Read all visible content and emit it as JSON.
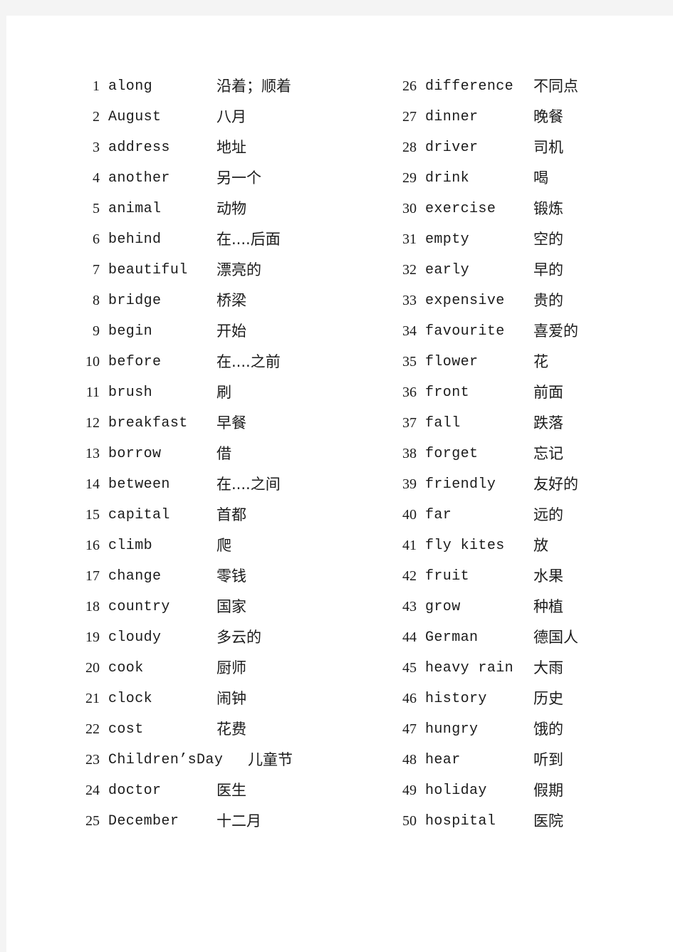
{
  "document": {
    "type": "vocabulary-list",
    "page_background": "#ffffff",
    "margin_background": "#f4f4f4",
    "text_color": "#1b1b1b",
    "total_entries": 50,
    "columns": 2
  },
  "columns": [
    {
      "name": "left-column",
      "entries": [
        {
          "num": "1",
          "word": "along",
          "gloss": "沿着；顺着"
        },
        {
          "num": "2",
          "word": "August",
          "gloss": "八月"
        },
        {
          "num": "3",
          "word": "address",
          "gloss": "地址"
        },
        {
          "num": "4",
          "word": "another",
          "gloss": "另一个"
        },
        {
          "num": "5",
          "word": "animal",
          "gloss": "动物"
        },
        {
          "num": "6",
          "word": "behind",
          "gloss": "在....后面"
        },
        {
          "num": "7",
          "word": "beautiful",
          "gloss": "漂亮的"
        },
        {
          "num": "8",
          "word": "bridge",
          "gloss": "桥梁"
        },
        {
          "num": "9",
          "word": "begin",
          "gloss": "开始"
        },
        {
          "num": "10",
          "word": "before",
          "gloss": "在....之前"
        },
        {
          "num": "11",
          "word": "brush",
          "gloss": "刷"
        },
        {
          "num": "12",
          "word": "breakfast",
          "gloss": "早餐"
        },
        {
          "num": "13",
          "word": "borrow",
          "gloss": "借"
        },
        {
          "num": "14",
          "word": "between",
          "gloss": "在....之间"
        },
        {
          "num": "15",
          "word": "capital",
          "gloss": "首都"
        },
        {
          "num": "16",
          "word": "climb",
          "gloss": "爬"
        },
        {
          "num": "17",
          "word": "change",
          "gloss": "零钱"
        },
        {
          "num": "18",
          "word": "country",
          "gloss": "国家"
        },
        {
          "num": "19",
          "word": "cloudy",
          "gloss": "多云的"
        },
        {
          "num": "20",
          "word": "cook",
          "gloss": "厨师"
        },
        {
          "num": "21",
          "word": "clock",
          "gloss": "闹钟"
        },
        {
          "num": "22",
          "word": "cost",
          "gloss": "花费"
        },
        {
          "num": "23",
          "word": "Children’sDay",
          "gloss": "儿童节",
          "wide": true
        },
        {
          "num": "24",
          "word": "doctor",
          "gloss": "医生"
        },
        {
          "num": "25",
          "word": "December",
          "gloss": "十二月"
        }
      ]
    },
    {
      "name": "right-column",
      "entries": [
        {
          "num": "26",
          "word": "difference",
          "gloss": "不同点"
        },
        {
          "num": "27",
          "word": "dinner",
          "gloss": "晚餐"
        },
        {
          "num": "28",
          "word": "driver",
          "gloss": "司机"
        },
        {
          "num": "29",
          "word": "drink",
          "gloss": "喝"
        },
        {
          "num": "30",
          "word": "exercise",
          "gloss": "锻炼"
        },
        {
          "num": "31",
          "word": "empty",
          "gloss": "空的"
        },
        {
          "num": "32",
          "word": "early",
          "gloss": "早的"
        },
        {
          "num": "33",
          "word": "expensive",
          "gloss": "贵的"
        },
        {
          "num": "34",
          "word": "favourite",
          "gloss": "喜爱的"
        },
        {
          "num": "35",
          "word": "flower",
          "gloss": "花"
        },
        {
          "num": "36",
          "word": "front",
          "gloss": "前面"
        },
        {
          "num": "37",
          "word": "fall",
          "gloss": "跌落"
        },
        {
          "num": "38",
          "word": "forget",
          "gloss": "忘记"
        },
        {
          "num": "39",
          "word": "friendly",
          "gloss": "友好的"
        },
        {
          "num": "40",
          "word": "far",
          "gloss": "远的"
        },
        {
          "num": "41",
          "word": "fly kites",
          "gloss": "放"
        },
        {
          "num": "42",
          "word": "fruit",
          "gloss": "水果"
        },
        {
          "num": "43",
          "word": "grow",
          "gloss": "种植"
        },
        {
          "num": "44",
          "word": "German",
          "gloss": "德国人"
        },
        {
          "num": "45",
          "word": "heavy rain",
          "gloss": "大雨"
        },
        {
          "num": "46",
          "word": "history",
          "gloss": "历史"
        },
        {
          "num": "47",
          "word": "hungry",
          "gloss": "饿的"
        },
        {
          "num": "48",
          "word": "hear",
          "gloss": "听到"
        },
        {
          "num": "49",
          "word": "holiday",
          "gloss": "假期"
        },
        {
          "num": "50",
          "word": "hospital",
          "gloss": "医院"
        }
      ]
    }
  ]
}
